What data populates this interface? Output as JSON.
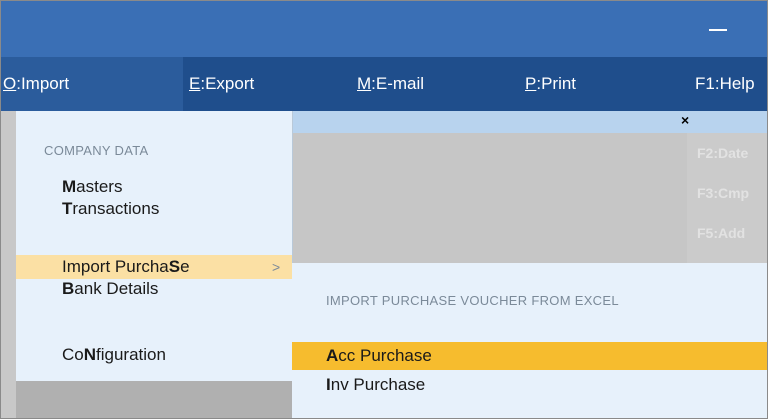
{
  "window": {
    "minimize_glyph": "—"
  },
  "menubar": {
    "items": [
      {
        "key": "O",
        "label": ":Import"
      },
      {
        "key": "E",
        "label": ":Export"
      },
      {
        "key": "M",
        "label": ":E-mail"
      },
      {
        "key": "P",
        "label": ":Print"
      },
      {
        "key": "F1",
        "label": ":Help"
      }
    ]
  },
  "background": {
    "close_glyph": "×",
    "ghost_items": [
      "F2:Date",
      "F3:Cmp",
      "F5:Add"
    ]
  },
  "dropdown": {
    "section_title": "COMPANY DATA",
    "masters": {
      "bold": "M",
      "rest": "asters"
    },
    "transactions": {
      "bold": "T",
      "rest": "ransactions"
    },
    "import_purchase": {
      "pre": "Import Purcha",
      "bold": "S",
      "post": "e",
      "chevron": ">"
    },
    "bank_details": {
      "bold": "B",
      "rest": "ank Details"
    },
    "configuration": {
      "pre": "Co",
      "bold": "N",
      "post": "figuration"
    }
  },
  "submenu": {
    "section_title": "IMPORT PURCHASE VOUCHER FROM EXCEL",
    "acc_purchase": {
      "bold": "A",
      "rest": "cc Purchase"
    },
    "inv_purchase": {
      "bold": "I",
      "rest": "nv Purchase"
    }
  },
  "colors": {
    "titlebar": "#3a6fb5",
    "menubar": "#1f4e8c",
    "menu_panel": "#e7f1fb",
    "hover_highlight": "#fbe0a4",
    "selected_highlight": "#f6bc2e"
  }
}
